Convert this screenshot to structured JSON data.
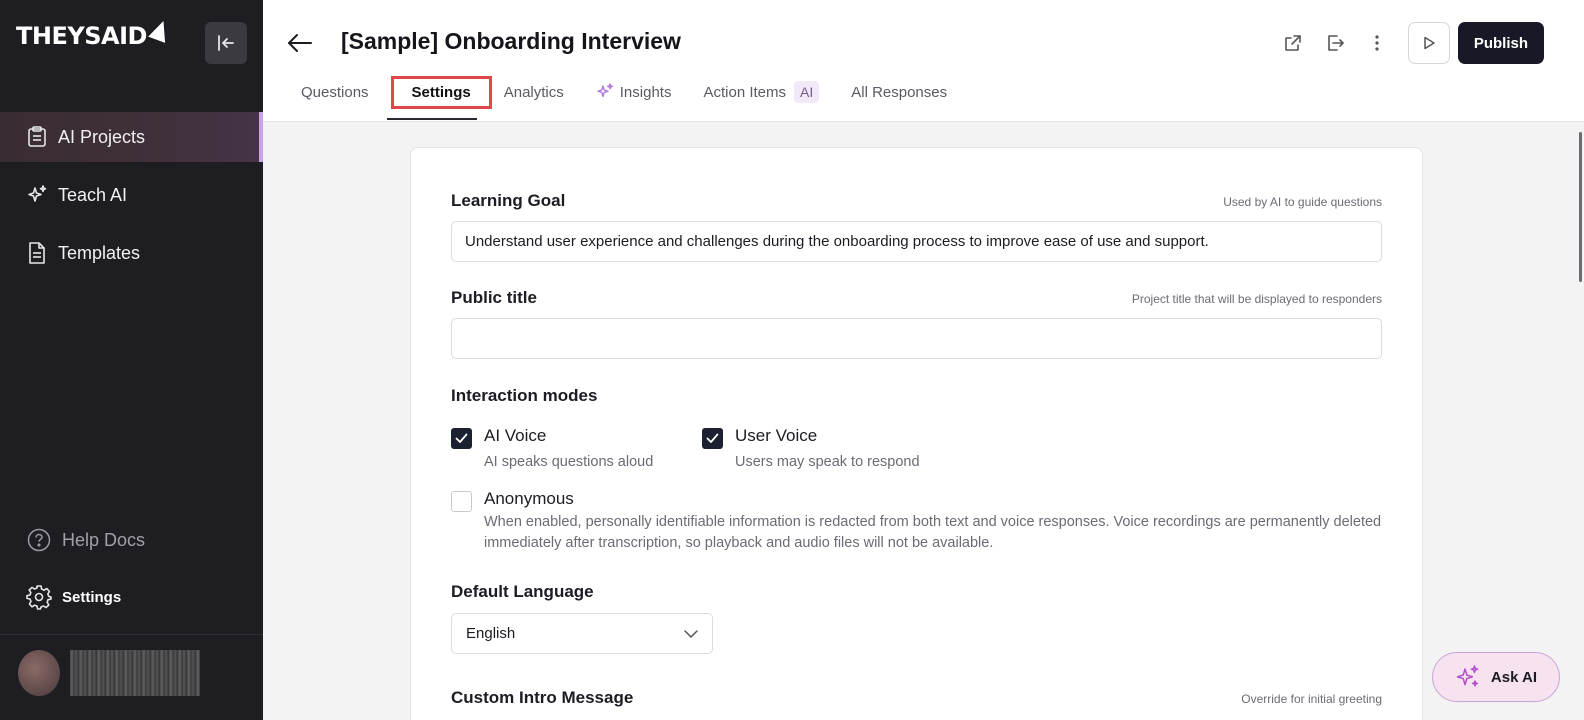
{
  "sidebar": {
    "logo": "THEYSAID",
    "items": [
      {
        "label": "AI Projects",
        "icon": "clipboard-icon",
        "active": true
      },
      {
        "label": "Teach AI",
        "icon": "sparkle-icon"
      },
      {
        "label": "Templates",
        "icon": "document-icon"
      }
    ],
    "help_label": "Help Docs",
    "settings_label": "Settings"
  },
  "header": {
    "title": "[Sample] Onboarding Interview",
    "publish_label": "Publish",
    "tabs": [
      {
        "label": "Questions"
      },
      {
        "label": "Settings",
        "active": true
      },
      {
        "label": "Analytics"
      },
      {
        "label": "Insights"
      },
      {
        "label": "Action Items",
        "badge": "AI"
      },
      {
        "label": "All Responses"
      }
    ]
  },
  "settings": {
    "learning_goal": {
      "label": "Learning Goal",
      "hint": "Used by AI to guide questions",
      "value": "Understand user experience and challenges during the onboarding process to improve ease of use and support."
    },
    "public_title": {
      "label": "Public title",
      "hint": "Project title that will be displayed to responders",
      "value": ""
    },
    "interaction_modes": {
      "label": "Interaction modes",
      "ai_voice": {
        "title": "AI Voice",
        "desc": "AI speaks questions aloud",
        "checked": true
      },
      "user_voice": {
        "title": "User Voice",
        "desc": "Users may speak to respond",
        "checked": true
      },
      "anonymous": {
        "title": "Anonymous",
        "desc": "When enabled, personally identifiable information is redacted from both text and voice responses. Voice recordings are permanently deleted immediately after transcription, so playback and audio files will not be available.",
        "checked": false
      }
    },
    "default_language": {
      "label": "Default Language",
      "value": "English"
    },
    "custom_intro": {
      "label": "Custom Intro Message",
      "hint": "Override for initial greeting"
    }
  },
  "ask_ai_label": "Ask AI",
  "colors": {
    "accent": "#171a26",
    "sidebar_bg": "#1e1e22",
    "highlight": "#e0464a"
  }
}
